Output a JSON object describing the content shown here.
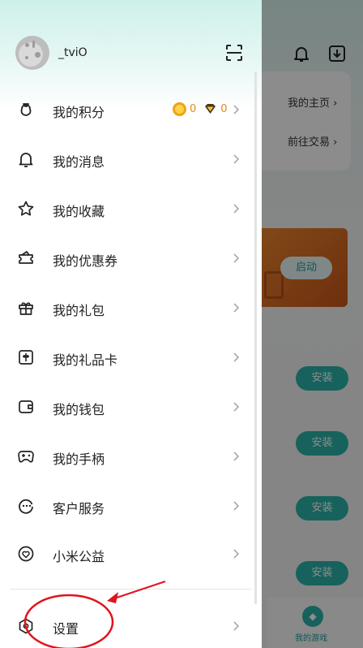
{
  "user": {
    "name": "_tviO"
  },
  "points": {
    "coins": "0",
    "diamonds": "0"
  },
  "menu": [
    {
      "key": "points",
      "label": "我的积分",
      "icon": "money-bag-icon"
    },
    {
      "key": "messages",
      "label": "我的消息",
      "icon": "bell-icon"
    },
    {
      "key": "favorites",
      "label": "我的收藏",
      "icon": "star-icon"
    },
    {
      "key": "coupons",
      "label": "我的优惠券",
      "icon": "coupon-icon"
    },
    {
      "key": "gifts",
      "label": "我的礼包",
      "icon": "gift-icon"
    },
    {
      "key": "giftcards",
      "label": "我的礼品卡",
      "icon": "giftcard-icon"
    },
    {
      "key": "wallet",
      "label": "我的钱包",
      "icon": "wallet-icon"
    },
    {
      "key": "gamepad",
      "label": "我的手柄",
      "icon": "gamepad-icon"
    },
    {
      "key": "service",
      "label": "客户服务",
      "icon": "support-icon"
    },
    {
      "key": "charity",
      "label": "小米公益",
      "icon": "heart-icon"
    },
    {
      "key": "settings",
      "label": "设置",
      "icon": "settings-icon"
    }
  ],
  "background": {
    "links": [
      "我的主页",
      "前往交易"
    ],
    "launch_label": "启动",
    "install_label": "安装",
    "tab_label": "我的游戏"
  },
  "colors": {
    "accent": "#2bb3a9",
    "annotation": "#e0141e",
    "coin": "#f0a313"
  }
}
